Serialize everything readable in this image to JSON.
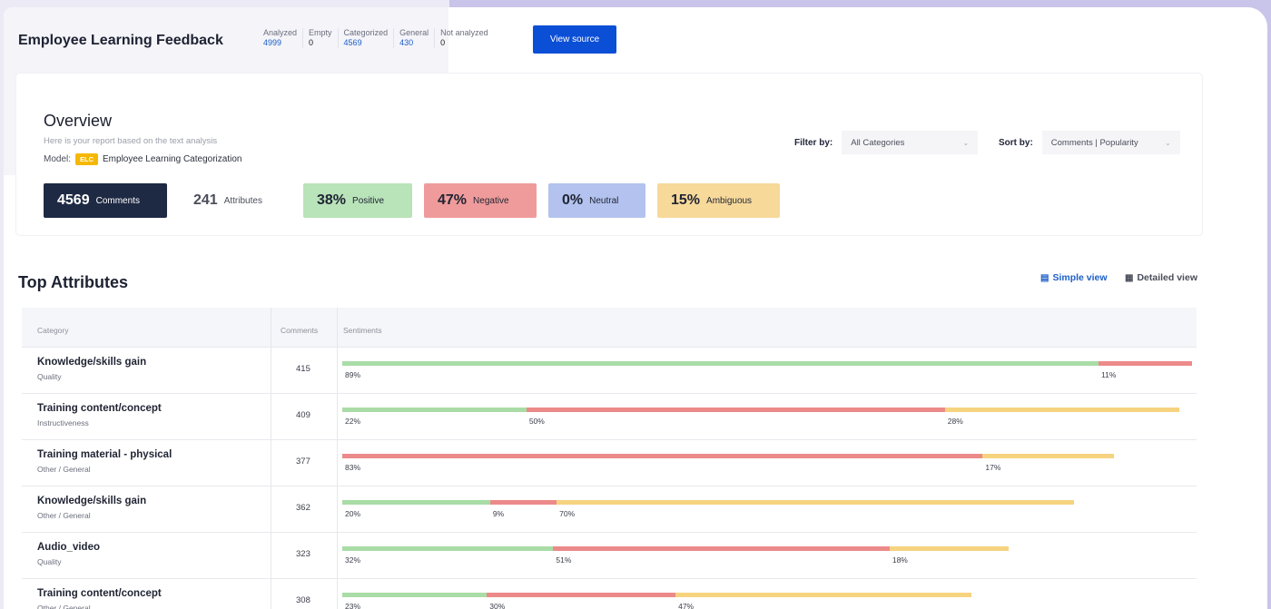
{
  "header": {
    "title": "Employee Learning Feedback",
    "stats": [
      {
        "label": "Analyzed",
        "value": "4999",
        "style": "link"
      },
      {
        "label": "Empty",
        "value": "0",
        "style": "dark"
      },
      {
        "label": "Categorized",
        "value": "4569",
        "style": "link"
      },
      {
        "label": "General",
        "value": "430",
        "style": "link"
      },
      {
        "label": "Not analyzed",
        "value": "0",
        "style": "dark"
      }
    ],
    "view_source_label": "View source"
  },
  "overview": {
    "title": "Overview",
    "subtitle": "Here is your report based on the text analysis",
    "model_label": "Model:",
    "model_badge": "ELC",
    "model_name": "Employee Learning Categorization",
    "filter_label": "Filter by:",
    "filter_value": "All Categories",
    "sort_label": "Sort by:",
    "sort_value": "Comments | Popularity",
    "metrics": [
      {
        "value": "4569",
        "label": "Comments",
        "bg": "#1e2a44",
        "fg": "#ffffff"
      },
      {
        "value": "241",
        "label": "Attributes",
        "bg": "#ffffff",
        "fg": "#4a4e5a"
      },
      {
        "value": "38%",
        "label": "Positive",
        "bg": "#b9e3b9",
        "fg": "#1f2433"
      },
      {
        "value": "47%",
        "label": "Negative",
        "bg": "#ef9b9b",
        "fg": "#1f2433"
      },
      {
        "value": "0%",
        "label": "Neutral",
        "bg": "#b3c2ee",
        "fg": "#1f2433"
      },
      {
        "value": "15%",
        "label": "Ambiguous",
        "bg": "#f7d99a",
        "fg": "#1f2433"
      }
    ]
  },
  "top_attributes": {
    "title": "Top Attributes",
    "simple_view_label": "Simple view",
    "detailed_view_label": "Detailed view",
    "columns": [
      "Category",
      "Comments",
      "Sentiments"
    ],
    "colors": {
      "positive": "#a9dca6",
      "negative": "#ec8a8a",
      "ambiguous": "#f6d37f"
    },
    "rows": [
      {
        "category": "Knowledge/skills gain",
        "sub": "Quality",
        "comments": "415",
        "segments": [
          {
            "type": "positive",
            "share": 0.89,
            "label": "89%"
          },
          {
            "type": "negative",
            "share": 0.11,
            "label": "11%"
          }
        ],
        "total_share": 1.0
      },
      {
        "category": "Training content/concept",
        "sub": "Instructiveness",
        "comments": "409",
        "segments": [
          {
            "type": "positive",
            "share": 0.22,
            "label": "22%"
          },
          {
            "type": "negative",
            "share": 0.5,
            "label": "50%"
          },
          {
            "type": "ambiguous",
            "share": 0.28,
            "label": "28%"
          }
        ],
        "total_share": 0.985
      },
      {
        "category": "Training material - physical",
        "sub": "Other / General",
        "comments": "377",
        "segments": [
          {
            "type": "negative",
            "share": 0.83,
            "label": "83%"
          },
          {
            "type": "ambiguous",
            "share": 0.17,
            "label": "17%"
          }
        ],
        "total_share": 0.908
      },
      {
        "category": "Knowledge/skills gain",
        "sub": "Other / General",
        "comments": "362",
        "segments": [
          {
            "type": "positive",
            "share": 0.2,
            "label": "20%"
          },
          {
            "type": "negative",
            "share": 0.09,
            "label": "9%"
          },
          {
            "type": "ambiguous",
            "share": 0.7,
            "label": "70%"
          }
        ],
        "total_share": 0.87
      },
      {
        "category": "Audio_video",
        "sub": "Quality",
        "comments": "323",
        "segments": [
          {
            "type": "positive",
            "share": 0.32,
            "label": "32%"
          },
          {
            "type": "negative",
            "share": 0.51,
            "label": "51%"
          },
          {
            "type": "ambiguous",
            "share": 0.18,
            "label": "18%"
          }
        ],
        "total_share": 0.776
      },
      {
        "category": "Training content/concept",
        "sub": "Other / General",
        "comments": "308",
        "segments": [
          {
            "type": "positive",
            "share": 0.23,
            "label": "23%"
          },
          {
            "type": "negative",
            "share": 0.3,
            "label": "30%"
          },
          {
            "type": "ambiguous",
            "share": 0.47,
            "label": "47%"
          }
        ],
        "total_share": 0.74
      }
    ]
  }
}
